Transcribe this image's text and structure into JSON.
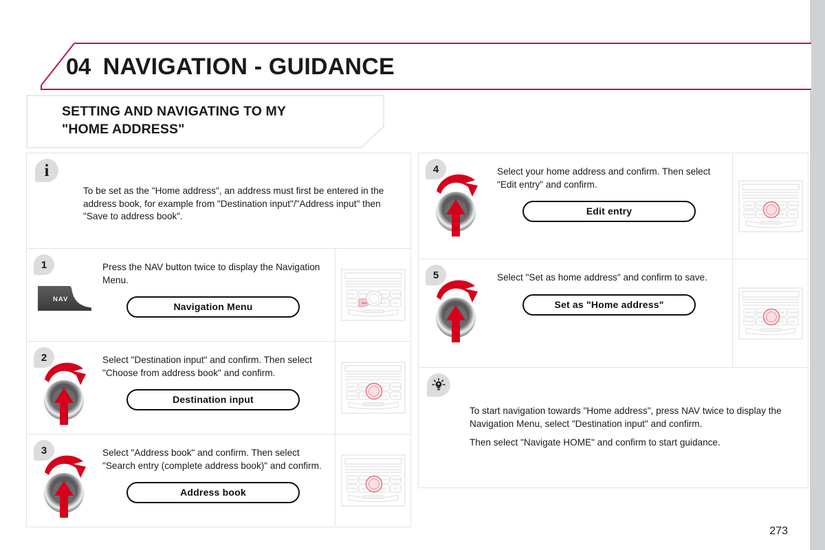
{
  "header": {
    "chapter_number": "04",
    "chapter_title": "NAVIGATION - GUIDANCE",
    "accent_color": "#c4143c"
  },
  "subtitle": {
    "line1": "SETTING AND NAVIGATING TO MY",
    "line2": "\"HOME ADDRESS\""
  },
  "info_note": {
    "icon": "info-icon",
    "text": "To be set as the \"Home address\", an address must first be entered in the address book, for example from \"Destination input\"/\"Address input\" then \"Save to address book\"."
  },
  "steps": [
    {
      "number": "1",
      "icon": "nav-button-icon",
      "nav_button_label": "NAV",
      "description": "Press the NAV button twice to display the Navigation Menu.",
      "pill_label": "Navigation Menu",
      "thumbnail": "radio-panel-nav-highlighted-thumbnail"
    },
    {
      "number": "2",
      "icon": "rotary-knob-icon",
      "description": "Select \"Destination input\" and confirm. Then select \"Choose from address book\" and confirm.",
      "pill_label": "Destination input",
      "thumbnail": "radio-panel-knob-highlighted-thumbnail"
    },
    {
      "number": "3",
      "icon": "rotary-knob-icon",
      "description": "Select \"Address book\" and confirm. Then select \"Search entry (complete address book)\" and confirm.",
      "pill_label": "Address book",
      "thumbnail": "radio-panel-knob-highlighted-thumbnail"
    },
    {
      "number": "4",
      "icon": "rotary-knob-icon",
      "description": "Select your home address and confirm. Then select \"Edit entry\" and confirm.",
      "pill_label": "Edit entry",
      "thumbnail": "radio-panel-knob-highlighted-thumbnail"
    },
    {
      "number": "5",
      "icon": "rotary-knob-icon",
      "description": "Select \"Set as home address\" and confirm to save.",
      "pill_label": "Set as \"Home address\"",
      "thumbnail": "radio-panel-knob-highlighted-thumbnail"
    }
  ],
  "tip_note": {
    "icon": "tip-bulb-icon",
    "paragraph1": "To start navigation towards \"Home address\", press NAV twice to display the Navigation Menu, select \"Destination input\" and confirm.",
    "paragraph2": "Then select \"Navigate HOME\" and confirm to start guidance."
  },
  "footer": {
    "page_number": "273"
  },
  "radio_panel": {
    "button_labels_row1": [
      "RADIO",
      "MODE",
      "SETUP",
      "TRAFFIC"
    ],
    "button_labels_row2": [
      "PHONE",
      "NAV",
      "NAVIG",
      "ESC"
    ]
  }
}
